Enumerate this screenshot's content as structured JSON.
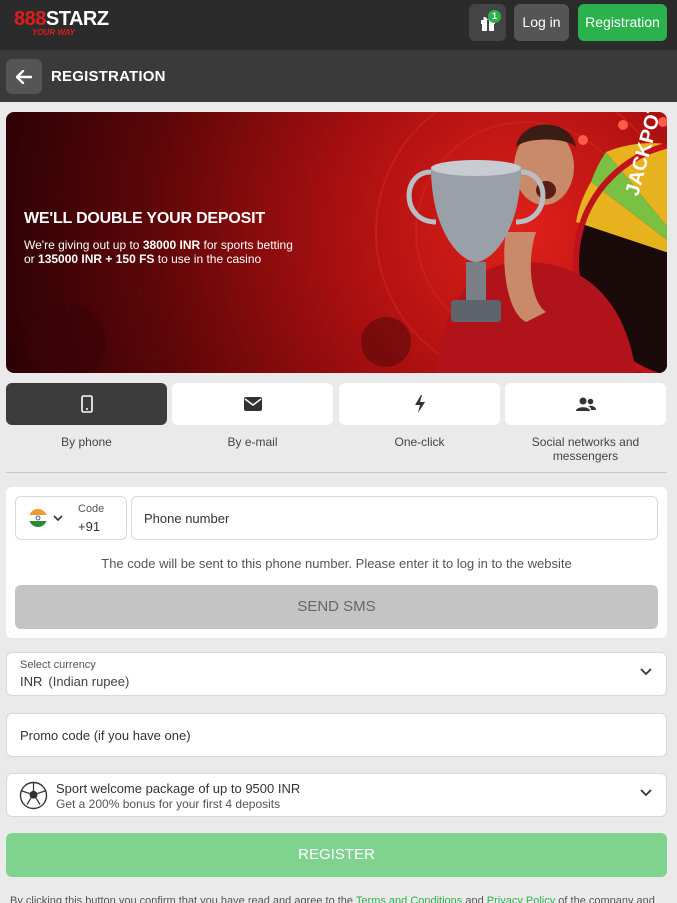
{
  "header": {
    "logo_text_prefix": "888",
    "logo_text": "STARZ",
    "logo_tagline": "YOUR WAY",
    "gift_badge_count": "1",
    "login_label": "Log in",
    "registration_label": "Registration"
  },
  "subheader": {
    "title": "REGISTRATION"
  },
  "banner": {
    "title": "WE'LL DOUBLE YOUR DEPOSIT",
    "line1_prefix": "We're giving out up to ",
    "line1_amount": "38000 INR",
    "line1_suffix": " for sports betting",
    "line2_prefix": "or ",
    "line2_amount": "135000 INR + 150 FS",
    "line2_suffix": " to use in the casino",
    "wheel_text": "JACKPOT"
  },
  "tabs": [
    {
      "label": "By phone",
      "icon": "phone-icon",
      "active": true
    },
    {
      "label": "By e-mail",
      "icon": "envelope-icon",
      "active": false
    },
    {
      "label": "One-click",
      "icon": "lightning-icon",
      "active": false
    },
    {
      "label": "Social networks and messengers",
      "icon": "users-icon",
      "active": false
    }
  ],
  "phone_form": {
    "code_label": "Code",
    "code_value": "+91",
    "phone_placeholder": "Phone number",
    "note": "The code will be sent to this phone number. Please enter it to log in to the website",
    "send_label": "SEND SMS"
  },
  "currency": {
    "label": "Select currency",
    "code": "INR",
    "name": "(Indian rupee)"
  },
  "promo": {
    "placeholder": "Promo code (if you have one)"
  },
  "bonus": {
    "title": "Sport welcome package of up to 9500 INR",
    "subtitle": "Get a 200% bonus for your first 4 deposits"
  },
  "register_label": "REGISTER",
  "terms": {
    "prefix": "By clicking this button you confirm that you have read and agree to the ",
    "link1": "Terms and Conditions",
    "middle": " and ",
    "link2": "Privacy Policy",
    "suffix": " of the company and"
  },
  "colors": {
    "green": "#2bb24c",
    "register_disabled": "#7fd38f",
    "brand_red": "#e21b1b",
    "dark": "#2b2b2b"
  }
}
